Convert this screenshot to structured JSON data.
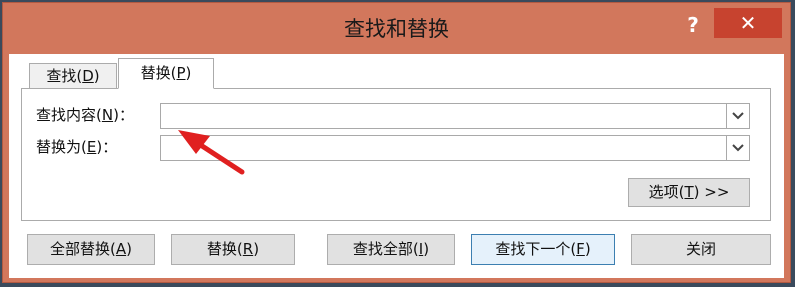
{
  "window": {
    "title": "查找和替换",
    "help_label": "?",
    "close_label": "✕"
  },
  "tabs": [
    {
      "label_pre": "查找(",
      "mnemonic": "D",
      "label_post": ")"
    },
    {
      "label_pre": "替换(",
      "mnemonic": "P",
      "label_post": ")"
    }
  ],
  "fields": {
    "find": {
      "label_pre": "查找内容(",
      "mnemonic": "N",
      "label_post": ")：",
      "value": ""
    },
    "replace": {
      "label_pre": "替换为(",
      "mnemonic": "E",
      "label_post": ")：",
      "value": ""
    }
  },
  "options_button": {
    "label_pre": "选项(",
    "mnemonic": "T",
    "label_post": ") >>"
  },
  "buttons": [
    {
      "label_pre": "全部替换(",
      "mnemonic": "A",
      "label_post": ")"
    },
    {
      "label_pre": "替换(",
      "mnemonic": "R",
      "label_post": ")"
    },
    {
      "label_pre": "查找全部(",
      "mnemonic": "I",
      "label_post": ")"
    },
    {
      "label_pre": "查找下一个(",
      "mnemonic": "F",
      "label_post": ")"
    },
    {
      "label_pre": "关闭",
      "mnemonic": "",
      "label_post": ""
    }
  ],
  "colors": {
    "title_bar": "#d2775c",
    "close_button": "#c7432f",
    "annotation_arrow": "#e02020"
  },
  "icons": {
    "dropdown": "chevron-down-icon",
    "annotation": "red-arrow-annotation"
  }
}
